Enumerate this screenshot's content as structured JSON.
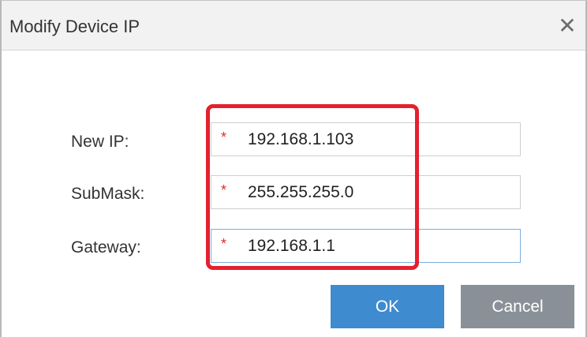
{
  "dialog": {
    "title": "Modify Device IP",
    "close_glyph": "✕"
  },
  "fields": [
    {
      "label": "New IP:",
      "required_mark": "*",
      "value": "192.168.1.103"
    },
    {
      "label": "SubMask:",
      "required_mark": "*",
      "value": "255.255.255.0"
    },
    {
      "label": "Gateway:",
      "required_mark": "*",
      "value": "192.168.1.1"
    }
  ],
  "buttons": {
    "ok_label": "OK",
    "cancel_label": "Cancel"
  },
  "colors": {
    "ok_button": "#3f8bd0",
    "cancel_button": "#8a9097",
    "highlight": "#e5202e",
    "required": "#e02b2b"
  }
}
